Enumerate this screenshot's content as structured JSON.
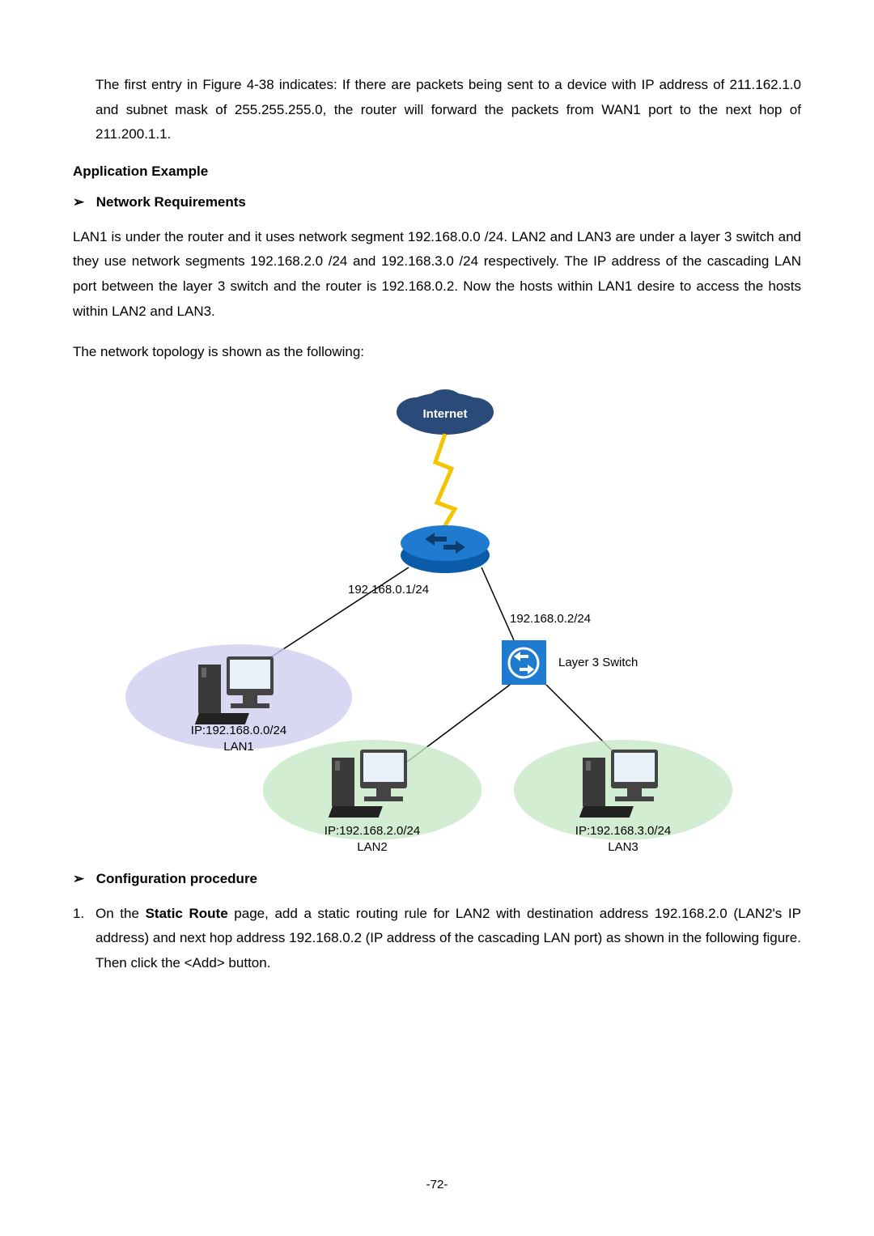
{
  "intro_para": "The first entry in Figure 4-38 indicates: If there are packets being sent to a device with IP address of 211.162.1.0 and subnet mask of 255.255.255.0, the router will forward the packets from WAN1 port to the next hop of 211.200.1.1.",
  "app_example_heading": "Application Example",
  "network_req_heading": "Network Requirements",
  "network_req_para": "LAN1 is under the router and it uses network segment 192.168.0.0 /24. LAN2 and LAN3 are under a layer 3 switch and they use network segments 192.168.2.0 /24 and 192.168.3.0 /24 respectively. The IP address of the cascading LAN port between the layer 3 switch and the router is 192.168.0.2. Now the hosts within LAN1 desire to access the hosts within LAN2 and LAN3.",
  "topology_para": "The network topology is shown as the following:",
  "diagram": {
    "internet_label": "Internet",
    "router_ip": "192.168.0.1/24",
    "switch_ip": "192.168.0.2/24",
    "switch_label": "Layer 3 Switch",
    "lan1_ip": "IP:192.168.0.0/24",
    "lan1_name": "LAN1",
    "lan2_ip": "IP:192.168.2.0/24",
    "lan2_name": "LAN2",
    "lan3_ip": "IP:192.168.3.0/24",
    "lan3_name": "LAN3"
  },
  "config_heading": "Configuration procedure",
  "step1_prefix": "On the ",
  "step1_bold": "Static Route",
  "step1_suffix": " page, add a static routing rule for LAN2 with destination address 192.168.2.0 (LAN2's IP address) and next hop address 192.168.0.2 (IP address of the cascading LAN port) as shown in the following figure. Then click the <Add> button.",
  "page_number": "-72-"
}
